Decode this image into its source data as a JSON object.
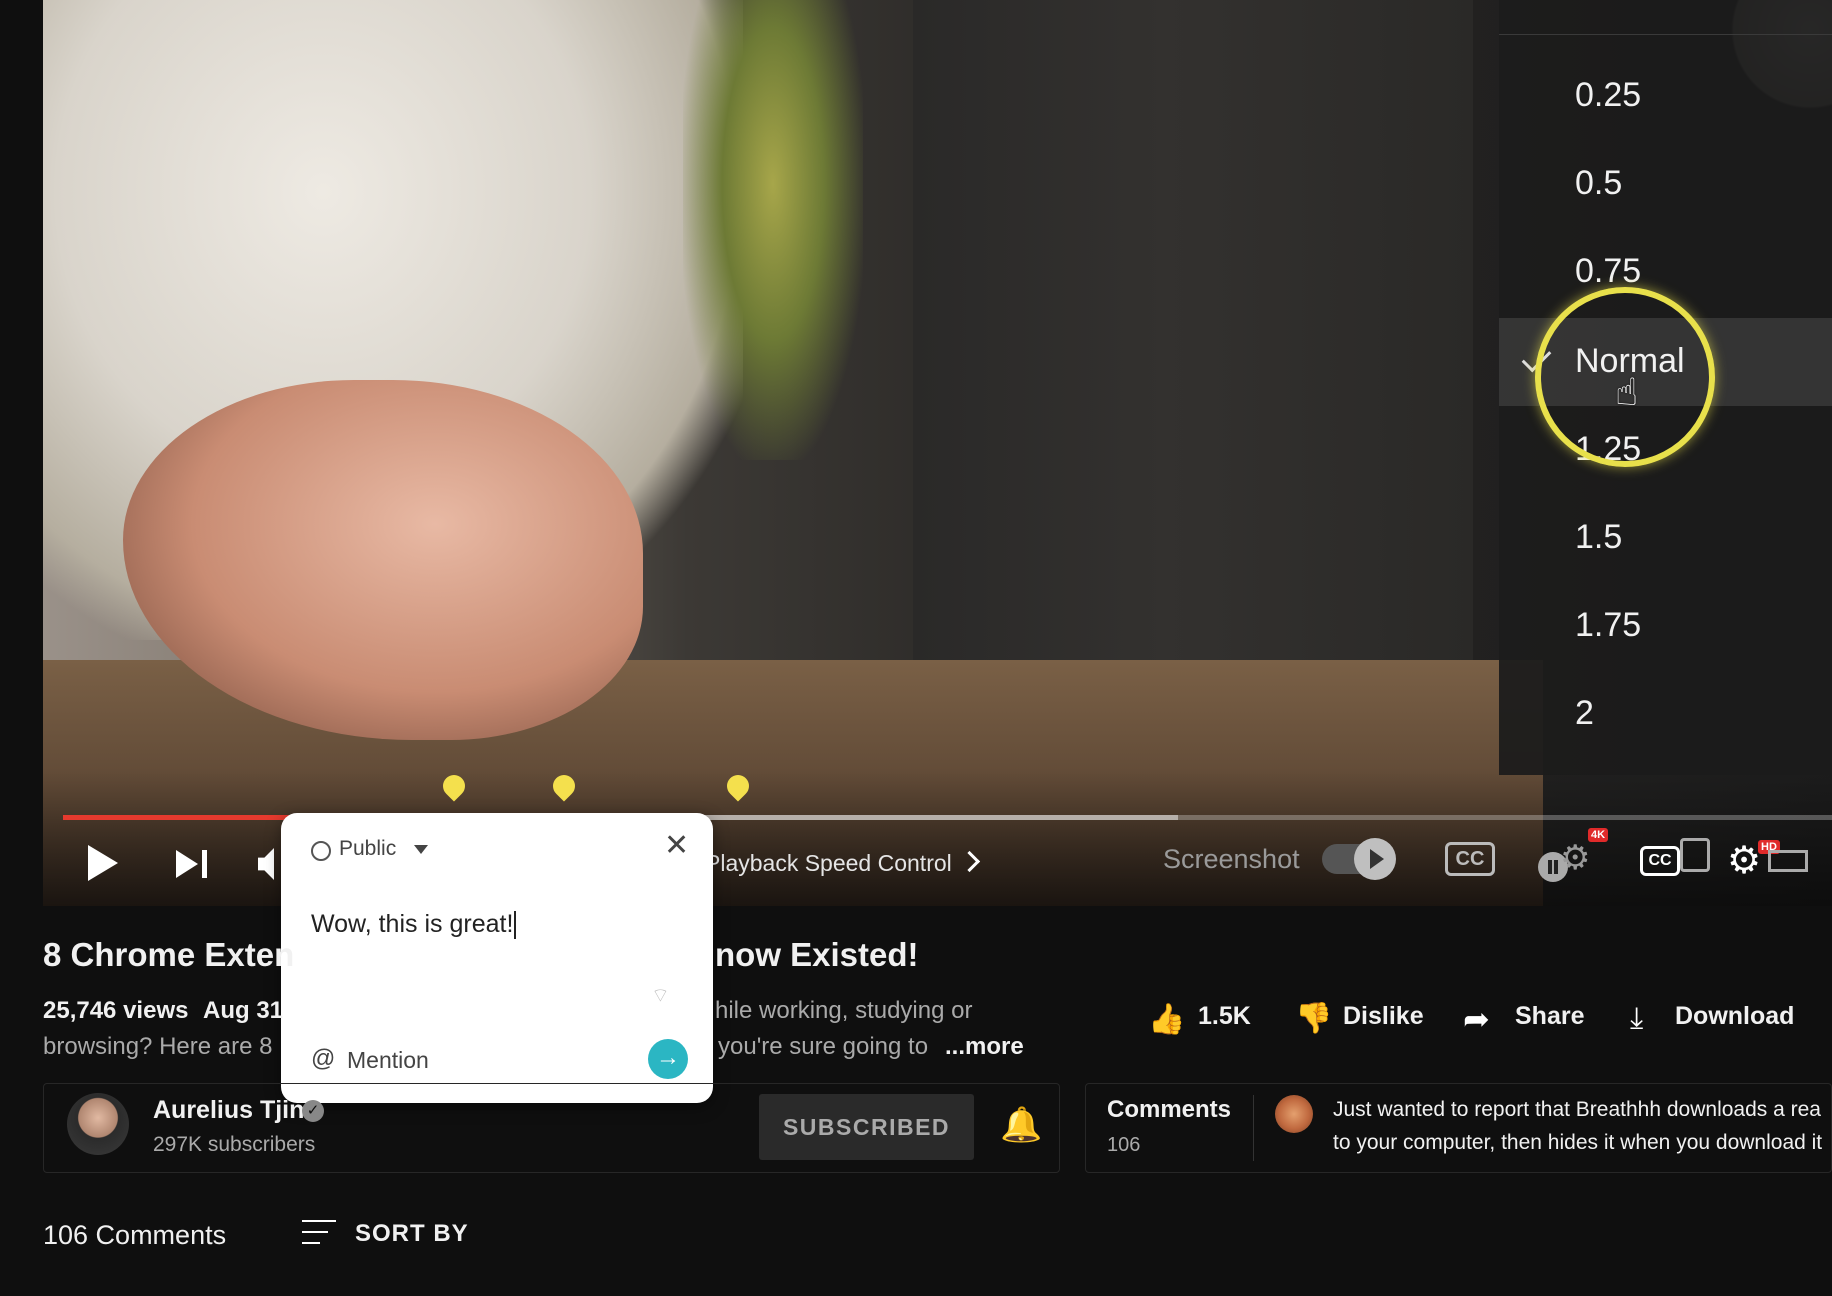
{
  "speed_menu": {
    "options": [
      "0.25",
      "0.5",
      "0.75",
      "Normal",
      "1.25",
      "1.5",
      "1.75",
      "2"
    ],
    "selected": "Normal"
  },
  "player": {
    "progress_fraction": 0.36,
    "chapter_label": "Playback Speed Control",
    "screenshot_label": "Screenshot",
    "cc_label": "CC",
    "badge_4k": "4K",
    "badge_hd": "HD",
    "colors": {
      "progress": "#e63a2e",
      "bookmark": "#f4e04d",
      "highlight": "#e8e04b"
    }
  },
  "popup": {
    "visibility": "Public",
    "comment_text": "Wow, this is great!",
    "mention_label": "Mention",
    "close_glyph": "✕",
    "at_glyph": "@",
    "send_color": "#2bb6c3"
  },
  "video": {
    "title_left": "8 Chrome Exten",
    "title_right": "now Existed!",
    "views": "25,746 views",
    "date": "Aug 31",
    "desc_left": "browsing? Here are 8",
    "desc_right_line1": "hile working, studying or",
    "desc_right_line2": "you're sure going to",
    "more_label": "...more"
  },
  "actions": {
    "like_count": "1.5K",
    "dislike_label": "Dislike",
    "share_label": "Share",
    "download_label": "Download"
  },
  "channel": {
    "name": "Aurelius Tjin",
    "subscribers": "297K subscribers",
    "subscribed_label": "SUBSCRIBED"
  },
  "comments_panel": {
    "title": "Comments",
    "count": "106",
    "preview_line1": "Just wanted to report that Breathhh downloads a rea",
    "preview_line2": "to your computer, then hides it when you download it"
  },
  "comments_section": {
    "heading": "106 Comments",
    "sort_label": "SORT BY"
  },
  "icons": [
    "play-icon",
    "next-icon",
    "volume-icon",
    "settings-icon",
    "thumbs-up-icon",
    "thumbs-down-icon",
    "share-icon",
    "download-icon",
    "bell-icon",
    "verified-icon",
    "globe-icon",
    "close-icon",
    "send-icon",
    "sort-icon"
  ]
}
